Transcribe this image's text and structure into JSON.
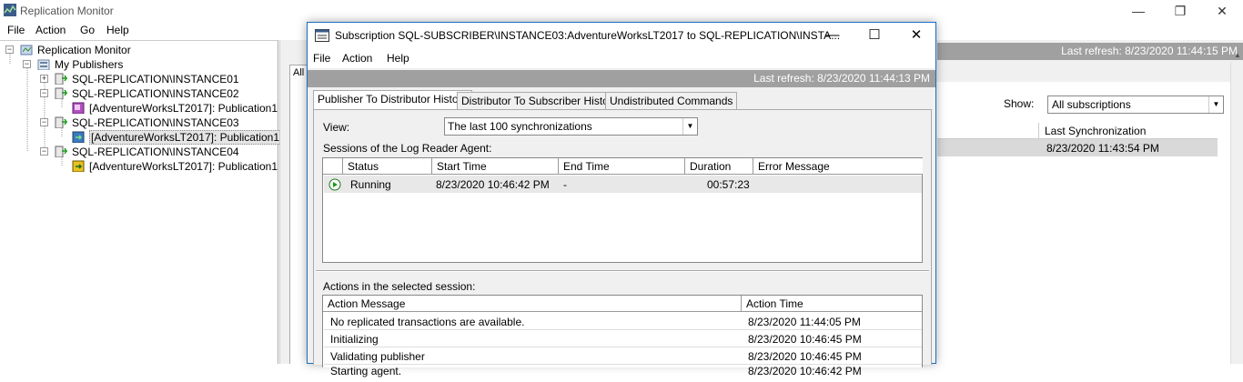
{
  "app": {
    "title": "Replication Monitor",
    "menu": [
      "File",
      "Action",
      "Go",
      "Help"
    ],
    "window_controls": {
      "minimize": "—",
      "restore": "❐",
      "close": "✕"
    }
  },
  "tree": {
    "root": "Replication Monitor",
    "publishers_folder": "My Publishers",
    "nodes": [
      {
        "label": "SQL-REPLICATION\\INSTANCE01",
        "expander": "+"
      },
      {
        "label": "SQL-REPLICATION\\INSTANCE02",
        "expander": "−"
      },
      {
        "label": "[AdventureWorksLT2017]: Publication1"
      },
      {
        "label": "SQL-REPLICATION\\INSTANCE03",
        "expander": "−"
      },
      {
        "label": "[AdventureWorksLT2017]: Publication1"
      },
      {
        "label": "SQL-REPLICATION\\INSTANCE04",
        "expander": "−"
      },
      {
        "label": "[AdventureWorksLT2017]: Publication1"
      }
    ]
  },
  "right_panel": {
    "last_refresh": "Last refresh: 8/23/2020 11:44:15 PM",
    "tab_label": "All",
    "show_label": "Show:",
    "show_value": "All subscriptions",
    "column_header": "Last Synchronization",
    "row_value": "8/23/2020 11:43:54 PM"
  },
  "dialog": {
    "title": "Subscription SQL-SUBSCRIBER\\INSTANCE03:AdventureWorksLT2017 to SQL-REPLICATION\\INSTA...",
    "menu": [
      "File",
      "Action",
      "Help"
    ],
    "last_refresh": "Last refresh: 8/23/2020 11:44:13 PM",
    "tabs": [
      "Publisher To Distributor History",
      "Distributor To Subscriber History",
      "Undistributed Commands"
    ],
    "active_tab": 0,
    "view_label": "View:",
    "view_value": "The last 100 synchronizations",
    "sessions_label": "Sessions of the Log Reader Agent:",
    "sessions_columns": [
      "Status",
      "Start Time",
      "End Time",
      "Duration",
      "Error Message"
    ],
    "sessions_rows": [
      {
        "status": "Running",
        "start": "8/23/2020 10:46:42 PM",
        "end": "-",
        "duration": "00:57:23",
        "error": ""
      }
    ],
    "actions_label": "Actions in the selected session:",
    "actions_columns": [
      "Action Message",
      "Action Time"
    ],
    "actions_rows": [
      {
        "message": "No replicated transactions are available.",
        "time": "8/23/2020 11:44:05 PM"
      },
      {
        "message": "Initializing",
        "time": "8/23/2020 10:46:45 PM"
      },
      {
        "message": "Validating publisher",
        "time": "8/23/2020 10:46:45 PM"
      },
      {
        "message": "Starting agent.",
        "time": "8/23/2020 10:46:42 PM"
      }
    ]
  }
}
